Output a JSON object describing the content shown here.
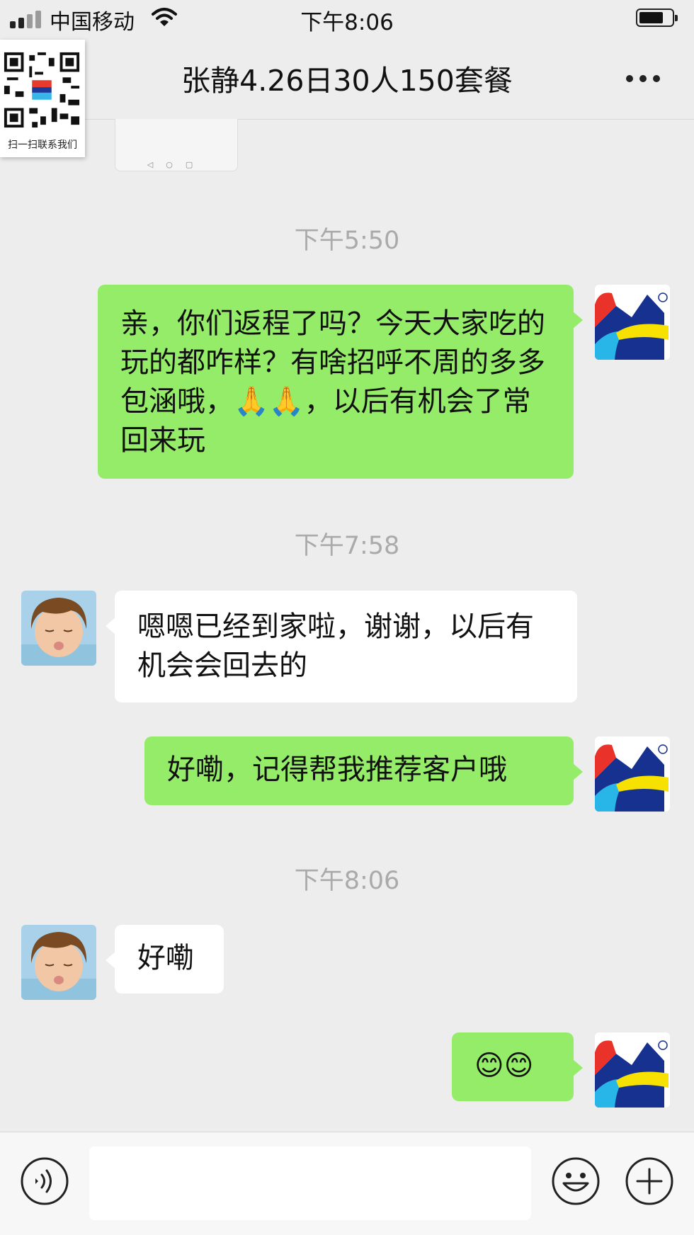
{
  "status_bar": {
    "carrier": "中国移动",
    "time": "下午8:06",
    "battery_level": 0.75
  },
  "nav": {
    "title": "张静4.26日30人150套餐"
  },
  "qr_badge": {
    "caption": "扫一扫联系我们"
  },
  "messages": [
    {
      "type": "timestamp",
      "text": "下午5:50"
    },
    {
      "type": "sent",
      "text": "亲，你们返程了吗？今天大家吃的玩的都咋样？有啥招呼不周的多多包涵哦，🙏🙏，以后有机会了常回来玩"
    },
    {
      "type": "timestamp",
      "text": "下午7:58"
    },
    {
      "type": "received",
      "text": "嗯嗯已经到家啦，谢谢，以后有机会会回去的"
    },
    {
      "type": "sent",
      "text": "好嘞，记得帮我推荐客户哦"
    },
    {
      "type": "timestamp",
      "text": "下午8:06"
    },
    {
      "type": "received",
      "text": "好嘞"
    },
    {
      "type": "sent",
      "text": "😊😊"
    }
  ],
  "input": {
    "value": "",
    "placeholder": ""
  },
  "icons": {
    "voice": "voice-icon",
    "emoji": "emoji-icon",
    "plus": "plus-icon",
    "more": "more-icon",
    "signal": "signal-icon",
    "wifi": "wifi-icon",
    "battery": "battery-icon"
  },
  "colors": {
    "sent_bubble": "#95ec69",
    "received_bubble": "#ffffff",
    "background": "#ededed"
  }
}
